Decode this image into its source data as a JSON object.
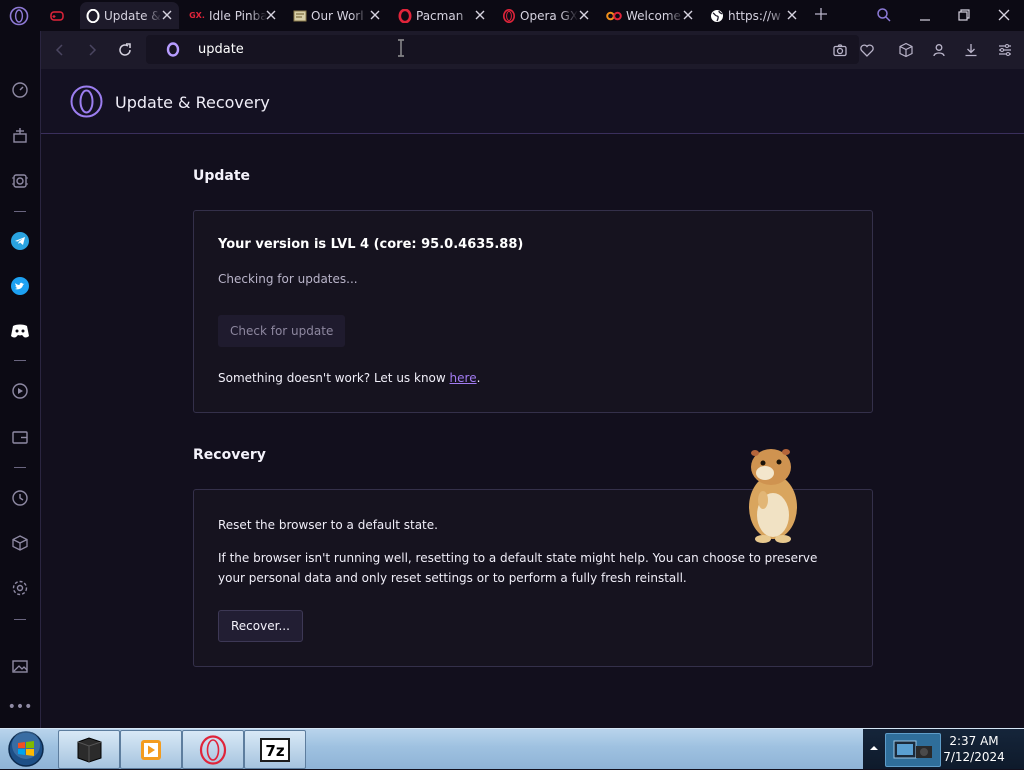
{
  "tabs": [
    {
      "title": "",
      "icon": "gamepad-icon",
      "active": false
    },
    {
      "title": "Update &",
      "icon": "opera-icon",
      "active": true
    },
    {
      "title": "Idle Pinba",
      "icon": "gx-icon",
      "active": false
    },
    {
      "title": "Our Worl",
      "icon": "newspaper-icon",
      "active": false
    },
    {
      "title": "Pacman",
      "icon": "opera-red-icon",
      "active": false
    },
    {
      "title": "Opera GX",
      "icon": "opera-red-icon",
      "active": false
    },
    {
      "title": "Welcome",
      "icon": "infinity-icon",
      "active": false
    },
    {
      "title": "https://w",
      "icon": "globe-icon",
      "active": false
    }
  ],
  "address_bar": {
    "value": "update"
  },
  "page": {
    "header_title": "Update & Recovery",
    "update": {
      "section_title": "Update",
      "version_text": "Your version is  LVL 4 (core: 95.0.4635.88)",
      "status_text": "Checking for updates...",
      "check_button": "Check for update",
      "help_prefix": "Something doesn't work? Let us know ",
      "help_link": "here",
      "help_suffix": "."
    },
    "recovery": {
      "section_title": "Recovery",
      "reset_title": "Reset the browser to a default state.",
      "reset_description": "If the browser isn't running well, resetting to a default state might help. You can choose to preserve your personal data and only reset settings or to perform a fully fresh reinstall.",
      "recover_button": "Recover..."
    }
  },
  "taskbar": {
    "clock_time": "2:37 AM",
    "clock_date": "7/12/2024",
    "pinned": [
      "terminal-icon",
      "media-player-icon",
      "opera-gx-icon",
      "7zip-icon"
    ]
  },
  "colors": {
    "accent": "#a27cf2",
    "background": "#120f1d",
    "opera_red": "#e0243a"
  }
}
